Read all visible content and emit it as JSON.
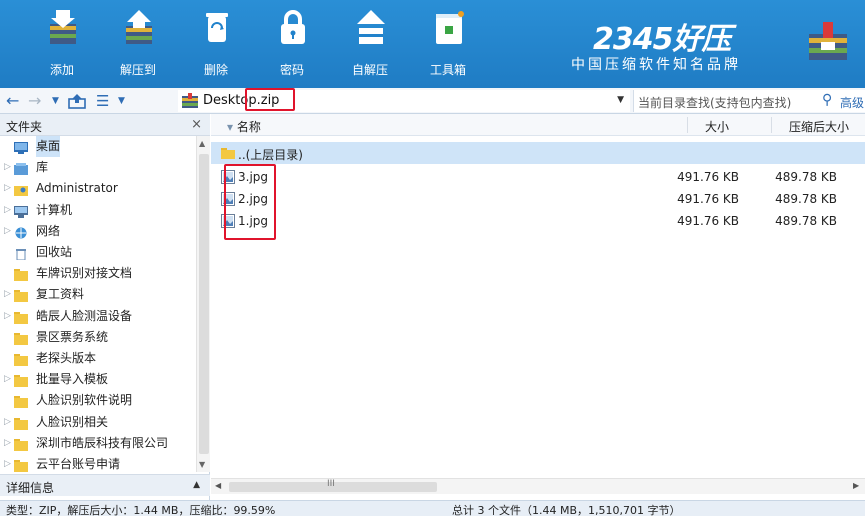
{
  "toolbar": {
    "tools": [
      {
        "label": "添加",
        "icon": "add-archive-icon"
      },
      {
        "label": "解压到",
        "icon": "extract-to-icon"
      },
      {
        "label": "删除",
        "icon": "delete-icon"
      },
      {
        "label": "密码",
        "icon": "lock-icon"
      },
      {
        "label": "自解压",
        "icon": "self-extract-icon"
      },
      {
        "label": "工具箱",
        "icon": "toolbox-icon"
      }
    ],
    "brand_title": "2345好压",
    "brand_subtitle": "中国压缩软件知名品牌",
    "colors": {
      "toolbar_bg": "#2182cb",
      "highlight_red": "#e0142c"
    }
  },
  "addressbar": {
    "path": "Desktop.zip",
    "search_placeholder": "当前目录查找(支持包内查找)",
    "advanced_label": "高级"
  },
  "leftpanel": {
    "title": "文件夹",
    "close_glyph": "×",
    "items": [
      {
        "label": "桌面",
        "selected": true,
        "expandable": false,
        "icon": "desktop-icon"
      },
      {
        "label": "库",
        "expandable": true,
        "icon": "library-icon"
      },
      {
        "label": "Administrator",
        "expandable": true,
        "icon": "user-folder-icon"
      },
      {
        "label": "计算机",
        "expandable": true,
        "icon": "computer-icon"
      },
      {
        "label": "网络",
        "expandable": true,
        "icon": "network-icon"
      },
      {
        "label": "回收站",
        "expandable": false,
        "icon": "recycle-bin-icon"
      },
      {
        "label": "车牌识别对接文档",
        "expandable": false,
        "icon": "folder-icon"
      },
      {
        "label": "复工资料",
        "expandable": true,
        "icon": "folder-icon"
      },
      {
        "label": "皓辰人脸测温设备",
        "expandable": true,
        "icon": "folder-icon"
      },
      {
        "label": "景区票务系统",
        "expandable": false,
        "icon": "folder-icon"
      },
      {
        "label": "老探头版本",
        "expandable": false,
        "icon": "folder-icon"
      },
      {
        "label": "批量导入模板",
        "expandable": true,
        "icon": "folder-icon"
      },
      {
        "label": "人脸识别软件说明",
        "expandable": false,
        "icon": "folder-icon"
      },
      {
        "label": "人脸识别相关",
        "expandable": true,
        "icon": "folder-icon"
      },
      {
        "label": "深圳市皓辰科技有限公司",
        "expandable": true,
        "icon": "folder-icon"
      },
      {
        "label": "云平台账号申请",
        "expandable": true,
        "icon": "folder-icon"
      }
    ],
    "details_title": "详细信息"
  },
  "filelist": {
    "columns": {
      "name": "名称",
      "size": "大小",
      "compressed": "压缩后大小"
    },
    "parent_row": "..(上层目录)",
    "rows": [
      {
        "name": "3.jpg",
        "size": "491.76 KB",
        "compressed": "489.78 KB"
      },
      {
        "name": "2.jpg",
        "size": "491.76 KB",
        "compressed": "489.78 KB"
      },
      {
        "name": "1.jpg",
        "size": "491.76 KB",
        "compressed": "489.78 KB"
      }
    ],
    "scroll_grip": "III"
  },
  "statusbar": {
    "left": "类型：ZIP，解压后大小：1.44 MB，压缩比：99.59%",
    "right": "总计 3 个文件（1.44 MB，1,510,701 字节）"
  }
}
